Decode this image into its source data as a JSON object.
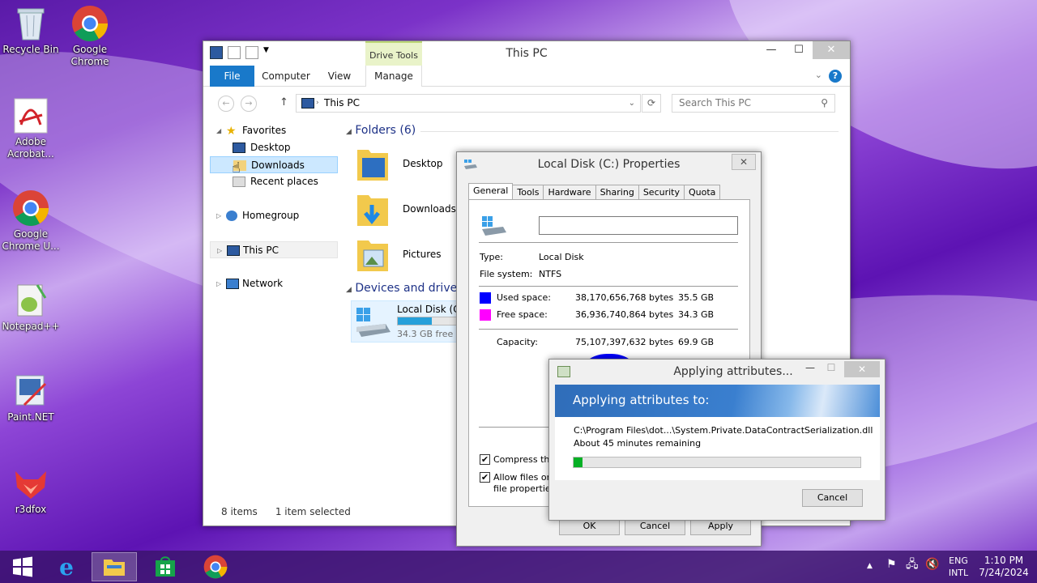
{
  "desktop": {
    "icons": [
      {
        "label": "Recycle Bin"
      },
      {
        "label": "Google Chrome"
      },
      {
        "label": "Adobe Acrobat..."
      },
      {
        "label": "Google Chrome U..."
      },
      {
        "label": "Notepad++"
      },
      {
        "label": "Paint.NET"
      },
      {
        "label": "r3dfox"
      }
    ]
  },
  "explorer": {
    "title": "This PC",
    "context_tab": "Drive Tools",
    "ribbon_tabs": [
      "File",
      "Computer",
      "View",
      "Manage"
    ],
    "address": "This PC",
    "search_placeholder": "Search This PC",
    "nav": {
      "favorites": "Favorites",
      "desktop": "Desktop",
      "downloads": "Downloads",
      "recent": "Recent places",
      "homegroup": "Homegroup",
      "thispc": "This PC",
      "network": "Network"
    },
    "folders_header": "Folders (6)",
    "folders": [
      "Desktop",
      "Downloads",
      "Pictures"
    ],
    "devices_header": "Devices and drives",
    "drive": {
      "name": "Local Disk (C:)",
      "free": "34.3 GB free of",
      "used_fraction": 0.51
    },
    "status_items": "8 items",
    "status_selected": "1 item selected"
  },
  "properties": {
    "title": "Local Disk (C:) Properties",
    "tabs": [
      "General",
      "Tools",
      "Hardware",
      "Sharing",
      "Security",
      "Quota"
    ],
    "volume_label": "",
    "type_label": "Type:",
    "type_value": "Local Disk",
    "fs_label": "File system:",
    "fs_value": "NTFS",
    "used_label": "Used space:",
    "used_bytes": "38,170,656,768 bytes",
    "used_gb": "35.5 GB",
    "free_label": "Free space:",
    "free_bytes": "36,936,740,864 bytes",
    "free_gb": "34.3 GB",
    "capacity_label": "Capacity:",
    "capacity_bytes": "75,107,397,632 bytes",
    "capacity_gb": "69.9 GB",
    "compress_label": "Compress this c",
    "index_label_1": "Allow files on th",
    "index_label_2": "file properties",
    "ok": "OK",
    "cancel": "Cancel",
    "apply": "Apply",
    "used_color": "#0000ff",
    "free_color": "#ff00ff"
  },
  "apply_dialog": {
    "title": "Applying attributes...",
    "banner": "Applying attributes to:",
    "path": "C:\\Program Files\\dot...\\System.Private.DataContractSerialization.dll",
    "remaining": "About 45 minutes remaining",
    "progress": 0.03,
    "cancel": "Cancel"
  },
  "taskbar": {
    "lang1": "ENG",
    "lang2": "INTL",
    "time": "1:10 PM",
    "date": "7/24/2024"
  }
}
